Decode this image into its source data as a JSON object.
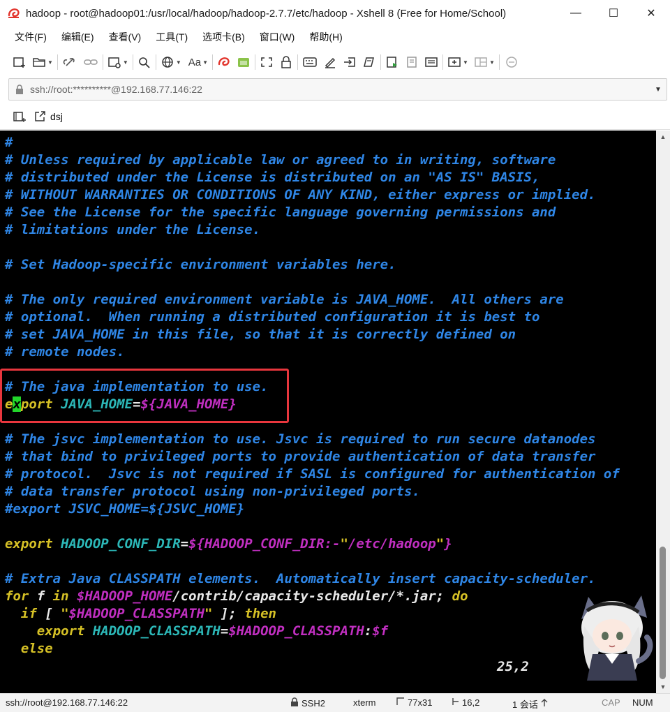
{
  "window": {
    "title": "hadoop - root@hadoop01:/usr/local/hadoop/hadoop-2.7.7/etc/hadoop - Xshell 8 (Free for Home/School)",
    "minimize": "—",
    "maximize": "☐",
    "close": "✕"
  },
  "menu": [
    "文件(F)",
    "编辑(E)",
    "查看(V)",
    "工具(T)",
    "选项卡(B)",
    "窗口(W)",
    "帮助(H)"
  ],
  "toolbar": {
    "font_label": "Aa"
  },
  "address": {
    "text": "ssh://root:**********@192.168.77.146:22"
  },
  "tabs": {
    "session_label": "dsj"
  },
  "terminal": {
    "lines": {
      "l0": "#",
      "l1": "# Unless required by applicable law or agreed to in writing, software",
      "l2": "# distributed under the License is distributed on an \"AS IS\" BASIS,",
      "l3": "# WITHOUT WARRANTIES OR CONDITIONS OF ANY KIND, either express or implied.",
      "l4": "# See the License for the specific language governing permissions and",
      "l5": "# limitations under the License.",
      "l7": "# Set Hadoop-specific environment variables here.",
      "l9": "# The only required environment variable is JAVA_HOME.  All others are",
      "l10": "# optional.  When running a distributed configuration it is best to",
      "l11": "# set JAVA_HOME in this file, so that it is correctly defined on",
      "l12": "# remote nodes.",
      "l14": "# The java implementation to use.",
      "l15_a": "e",
      "l15_b": "x",
      "l15_c": "port",
      "l15_d": " JAVA_HOME",
      "l15_e": "=",
      "l15_f": "${JAVA_HOME}",
      "l17": "# The jsvc implementation to use. Jsvc is required to run secure datanodes",
      "l18": "# that bind to privileged ports to provide authentication of data transfer",
      "l19": "# protocol.  Jsvc is not required if SASL is configured for authentication of",
      "l20": "# data transfer protocol using non-privileged ports.",
      "l21": "#export JSVC_HOME=${JSVC_HOME}",
      "l23_a": "export",
      "l23_b": " HADOOP_CONF_DIR",
      "l23_c": "=",
      "l23_d": "${HADOOP_CONF_DIR:-",
      "l23_e": "\"",
      "l23_f": "/etc/hadoop",
      "l23_g": "\"",
      "l23_h": "}",
      "l25": "# Extra Java CLASSPATH elements.  Automatically insert capacity-scheduler.",
      "l26_a": "for",
      "l26_b": " f ",
      "l26_c": "in",
      "l26_d": " ",
      "l26_e": "$HADOOP_HOME",
      "l26_f": "/contrib/capacity-scheduler/*.jar; ",
      "l26_g": "do",
      "l27_a": "  if",
      "l27_b": " [ ",
      "l27_c": "\"",
      "l27_d": "$HADOOP_CLASSPATH",
      "l27_e": "\"",
      "l27_f": " ]; ",
      "l27_g": "then",
      "l28_a": "    export",
      "l28_b": " HADOOP_CLASSPATH",
      "l28_c": "=",
      "l28_d": "$HADOOP_CLASSPATH",
      "l28_e": ":",
      "l28_f": "$f",
      "l29": "  else"
    },
    "cursor_position": "25,2"
  },
  "status": {
    "connection": "ssh://root@192.168.77.146:22",
    "protocol": "SSH2",
    "terminal_type": "xterm",
    "size": "77x31",
    "cursor": "16,2",
    "sessions": "1 会话",
    "caps": "CAP",
    "num": "NUM"
  },
  "colors": {
    "comment": "#2f86e6",
    "keyword": "#d6c126",
    "variable": "#2cb8b8",
    "string": "#c12fc1",
    "cursor": "#22d62a",
    "highlight_box": "#e8363d"
  }
}
